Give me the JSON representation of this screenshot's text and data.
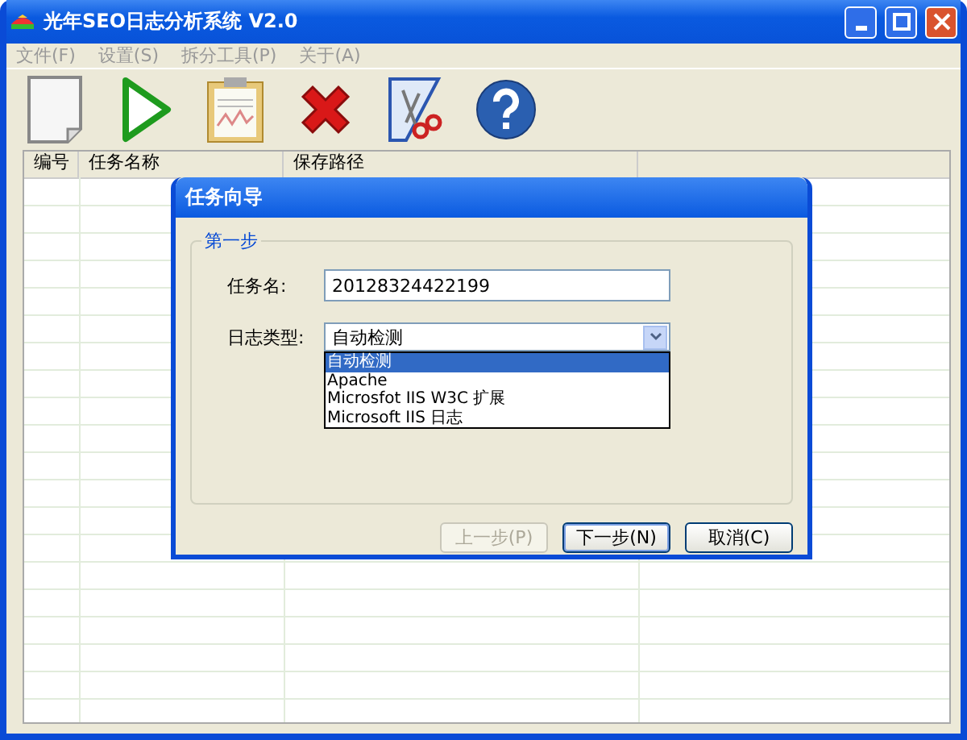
{
  "window": {
    "title": "光年SEO日志分析系统 V2.0"
  },
  "menu": [
    {
      "label": "文件(F)",
      "disabled": true
    },
    {
      "label": "设置(S)",
      "disabled": true
    },
    {
      "label": "拆分工具(P)",
      "disabled": true
    },
    {
      "label": "关于(A)",
      "disabled": true
    }
  ],
  "toolbar": [
    {
      "kind": "new"
    },
    {
      "kind": "run"
    },
    {
      "kind": "report"
    },
    {
      "kind": "delete"
    },
    {
      "kind": "split"
    },
    {
      "kind": "help"
    }
  ],
  "table": {
    "columns": [
      "编号",
      "任务名称",
      "保存路径"
    ]
  },
  "dialog": {
    "title": "任务向导",
    "group": "第一步",
    "task_name": {
      "label": "任务名:",
      "value": "20128324422199"
    },
    "log_type": {
      "label": "日志类型:",
      "value": "自动检测",
      "expanded": true,
      "options": [
        {
          "label": "自动检测",
          "selected": true
        },
        {
          "label": "Apache",
          "selected": false
        },
        {
          "label": "Microsfot IIS W3C 扩展",
          "selected": false
        },
        {
          "label": "Microsoft IIS 日志",
          "selected": false
        }
      ]
    },
    "buttons": [
      {
        "label": "上一步(P)",
        "disabled": true,
        "default": false
      },
      {
        "label": "下一步(N)",
        "disabled": false,
        "default": true
      },
      {
        "label": "取消(C)",
        "disabled": false,
        "default": false
      }
    ]
  }
}
